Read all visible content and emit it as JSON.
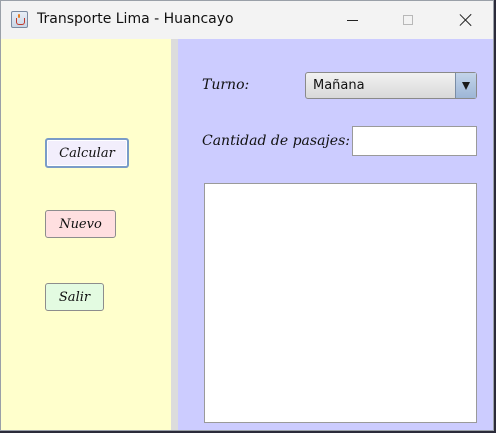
{
  "window": {
    "title": "Transporte Lima - Huancayo",
    "icon": "java-cup-icon"
  },
  "buttons": {
    "calcular": "Calcular",
    "nuevo": "Nuevo",
    "salir": "Salir"
  },
  "form": {
    "turno_label": "Turno:",
    "turno_value": "Mañana",
    "cantidad_label": "Cantidad de pasajes:",
    "cantidad_value": "",
    "output_text": ""
  },
  "colors": {
    "left_panel": "#ffffcc",
    "right_panel": "#ccccff",
    "calcular_bg": "#f2eefc",
    "nuevo_bg": "#ffdfe0",
    "salir_bg": "#e3fbe1"
  }
}
